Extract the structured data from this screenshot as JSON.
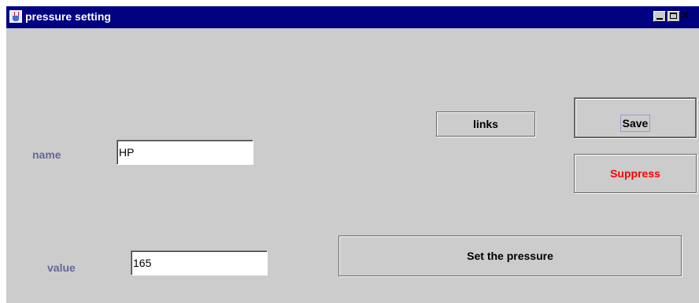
{
  "window": {
    "title": "pressure setting",
    "controls": {
      "minimize_icon": "minimize-icon",
      "maximize_icon": "maximize-icon",
      "close_icon": "close-icon",
      "close_glyph": "×"
    }
  },
  "form": {
    "name_label": "name",
    "name_value": "HP",
    "value_label": "value",
    "value_value": "165"
  },
  "buttons": {
    "links": "links",
    "save": "Save",
    "suppress": "Suppress",
    "set_pressure": "Set the pressure"
  },
  "colors": {
    "background": "#cccccc",
    "titlebar": "#000080",
    "label_text": "#666699",
    "suppress_text": "#ff0000"
  }
}
